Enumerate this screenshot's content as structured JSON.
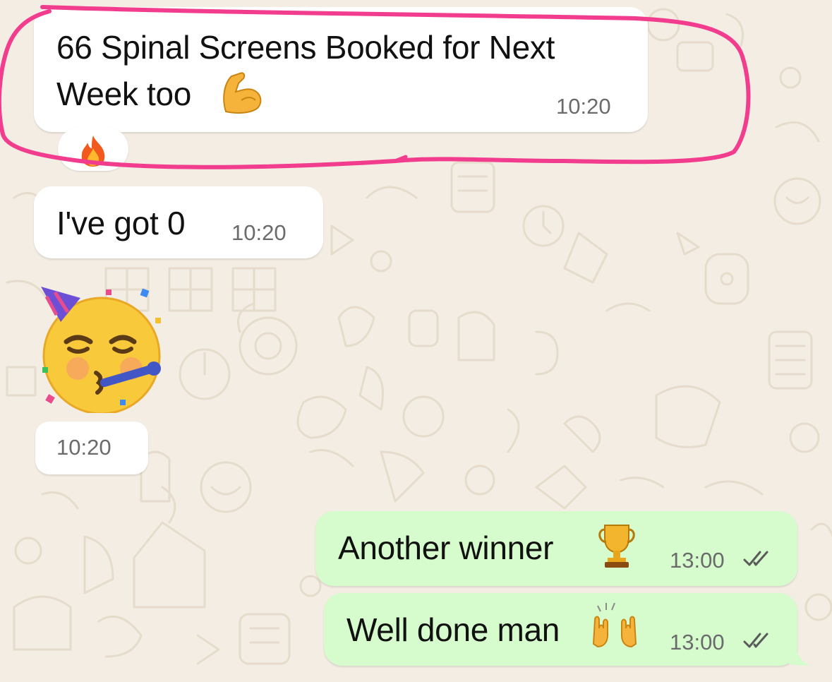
{
  "messages": [
    {
      "direction": "incoming",
      "text_line1": "66 Spinal Screens Booked for Next",
      "text_line2": "Week too",
      "emoji": "flexed-biceps",
      "time": "10:20",
      "reaction": "fire",
      "highlighted": true,
      "highlight_color": "#f23d8f"
    },
    {
      "direction": "incoming",
      "text": "I've got 0",
      "time": "10:20"
    },
    {
      "direction": "incoming",
      "sticker": "partying-face",
      "time": "10:20"
    },
    {
      "direction": "outgoing",
      "text": "Another winner",
      "emoji": "trophy",
      "time": "13:00",
      "status": "read"
    },
    {
      "direction": "outgoing",
      "text": "Well done man",
      "emoji": "raising-hands",
      "time": "13:00",
      "status": "read"
    }
  ],
  "colors": {
    "chat_background": "#f3ede3",
    "incoming_bubble": "#ffffff",
    "outgoing_bubble": "#d6fbcc",
    "highlight": "#f23d8f",
    "time_text": "#6b6b6b"
  }
}
